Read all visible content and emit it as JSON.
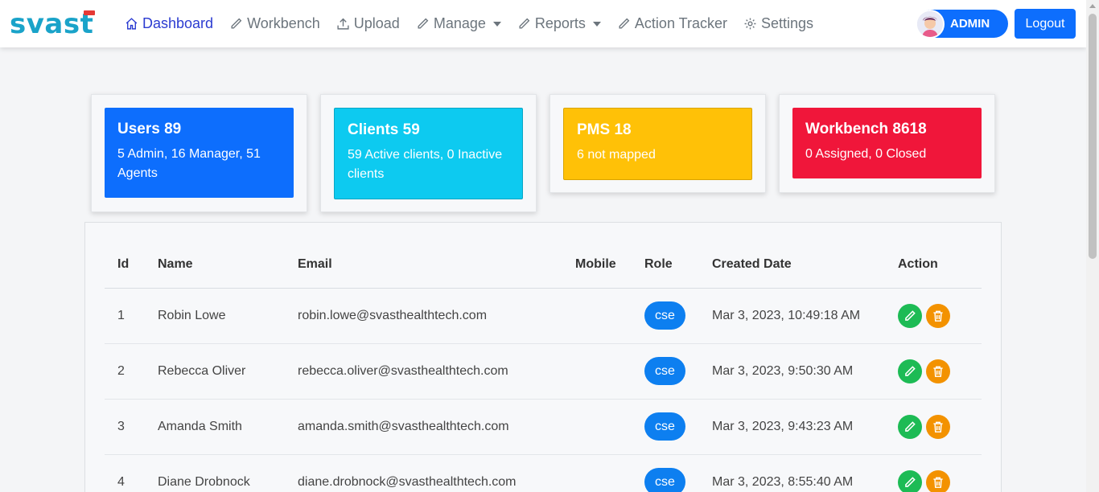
{
  "brand": {
    "logo_text_a": "svas",
    "logo_text_b": "t"
  },
  "nav": {
    "items": [
      {
        "label": "Dashboard",
        "icon": "home-icon"
      },
      {
        "label": "Workbench",
        "icon": "pencil-icon"
      },
      {
        "label": "Upload",
        "icon": "upload-icon"
      },
      {
        "label": "Manage",
        "icon": "pencil-icon"
      },
      {
        "label": "Reports",
        "icon": "pencil-icon"
      },
      {
        "label": "Action Tracker",
        "icon": "pencil-icon"
      },
      {
        "label": "Settings",
        "icon": "gear-icon"
      }
    ]
  },
  "user": {
    "label": "ADMIN",
    "logout_label": "Logout"
  },
  "cards": [
    {
      "title": "Users 89",
      "subtitle": "5 Admin, 16 Manager, 51 Agents",
      "color": "#0d6efd"
    },
    {
      "title": "Clients 59",
      "subtitle": "59 Active clients, 0 Inactive clients",
      "color": "#0dcaf0"
    },
    {
      "title": "PMS 18",
      "subtitle": "6 not mapped",
      "color": "#ffc107"
    },
    {
      "title": "Workbench 8618",
      "subtitle": "0 Assigned, 0 Closed",
      "color": "#f0163a"
    }
  ],
  "table": {
    "columns": [
      "Id",
      "Name",
      "Email",
      "Mobile",
      "Role",
      "Created Date",
      "Action"
    ],
    "rows": [
      {
        "id": "1",
        "name": "Robin Lowe",
        "email": "robin.lowe@svasthealthtech.com",
        "mobile": "",
        "role": "cse",
        "created": "Mar 3, 2023, 10:49:18 AM"
      },
      {
        "id": "2",
        "name": "Rebecca Oliver",
        "email": "rebecca.oliver@svasthealthtech.com",
        "mobile": "",
        "role": "cse",
        "created": "Mar 3, 2023, 9:50:30 AM"
      },
      {
        "id": "3",
        "name": "Amanda Smith",
        "email": "amanda.smith@svasthealthtech.com",
        "mobile": "",
        "role": "cse",
        "created": "Mar 3, 2023, 9:43:23 AM"
      },
      {
        "id": "4",
        "name": "Diane Drobnock",
        "email": "diane.drobnock@svasthealthtech.com",
        "mobile": "",
        "role": "cse",
        "created": "Mar 3, 2023, 8:55:40 AM"
      }
    ]
  }
}
